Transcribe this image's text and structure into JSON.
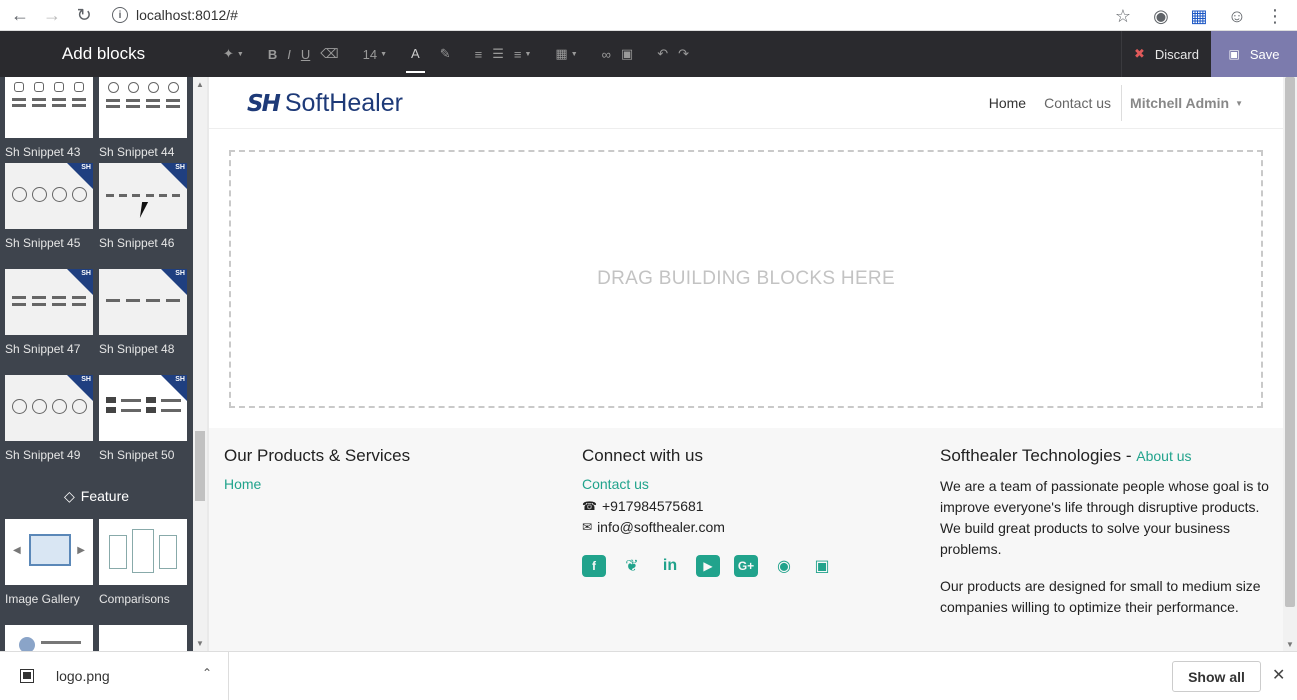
{
  "browser": {
    "url": "localhost:8012/#",
    "info_icon": "info-icon"
  },
  "editor": {
    "add_blocks_title": "Add blocks",
    "font_size": "14",
    "discard_label": "Discard",
    "save_label": "Save"
  },
  "sidebar": {
    "blocks": [
      {
        "label": "Sh Snippet 43"
      },
      {
        "label": "Sh Snippet 44"
      },
      {
        "label": "Sh Snippet 45"
      },
      {
        "label": "Sh Snippet 46"
      },
      {
        "label": "Sh Snippet 47"
      },
      {
        "label": "Sh Snippet 48"
      },
      {
        "label": "Sh Snippet 49"
      },
      {
        "label": "Sh Snippet 50"
      }
    ],
    "badge": "SH",
    "feature_heading": "Feature",
    "feature_blocks": [
      {
        "label": "Image Gallery"
      },
      {
        "label": "Comparisons"
      }
    ]
  },
  "site": {
    "logo_mark": "SH",
    "logo_text": "SoftHealer",
    "menu": {
      "home": "Home",
      "contact": "Contact us",
      "user": "Mitchell Admin"
    },
    "dropzone_text": "DRAG BUILDING BLOCKS HERE"
  },
  "footer": {
    "col1": {
      "heading": "Our Products & Services",
      "link": "Home"
    },
    "col2": {
      "heading": "Connect with us",
      "link": "Contact us",
      "phone": "+917984575681",
      "email": "info@softhealer.com",
      "socials": [
        "facebook-icon",
        "twitter-icon",
        "linkedin-icon",
        "youtube-icon",
        "google-plus-icon",
        "github-icon",
        "instagram-icon"
      ]
    },
    "col3": {
      "heading": "Softhealer Technologies",
      "heading_sep": " - ",
      "about_link": "About us",
      "para1": "We are a team of passionate people whose goal is to improve everyone's life through disruptive products. We build great products to solve your business problems.",
      "para2": "Our products are designed for small to medium size companies willing to optimize their performance."
    }
  },
  "downloads": {
    "file_name": "logo.png",
    "show_all": "Show all"
  }
}
